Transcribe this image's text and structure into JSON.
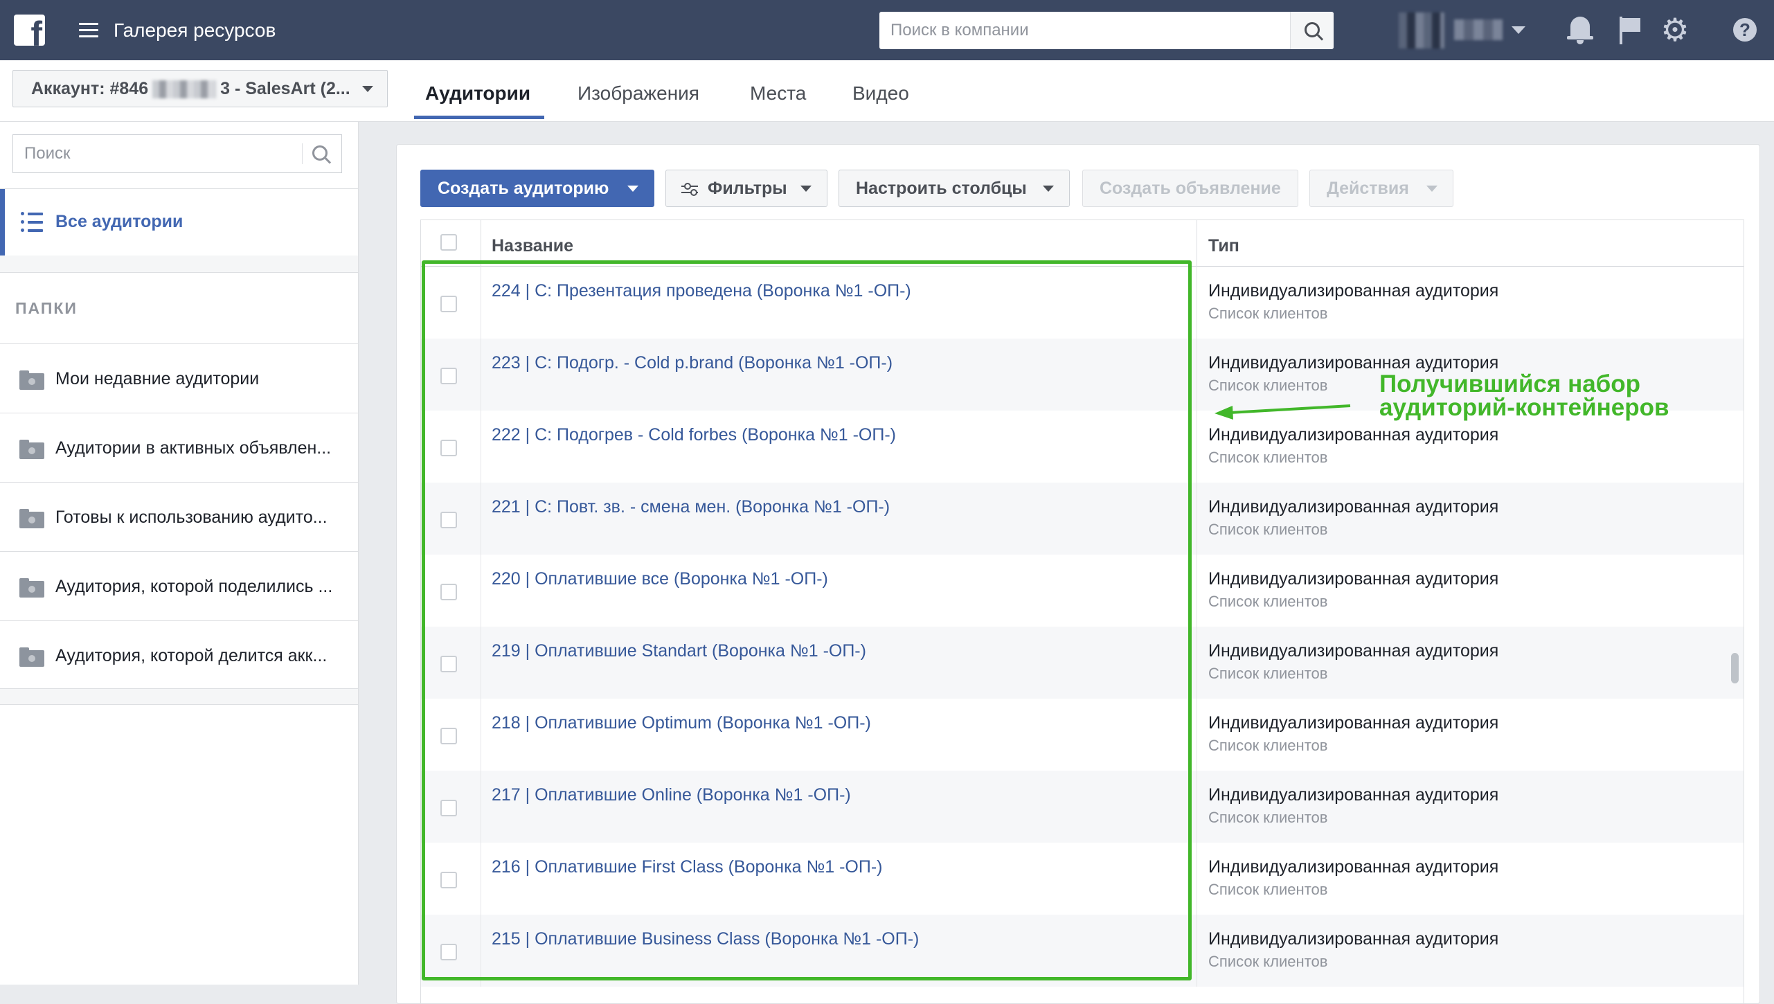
{
  "topbar": {
    "app_title": "Галерея ресурсов",
    "search_placeholder": "Поиск в компании",
    "help_label": "?"
  },
  "subheader": {
    "account_prefix": "Аккаунт: #846",
    "account_suffix": "3 - SalesArt (2...",
    "tabs": [
      {
        "label": "Аудитории",
        "active": true
      },
      {
        "label": "Изображения",
        "active": false
      },
      {
        "label": "Места",
        "active": false
      },
      {
        "label": "Видео",
        "active": false
      }
    ]
  },
  "sidebar": {
    "search_placeholder": "Поиск",
    "all_audiences": "Все аудитории",
    "folders_title": "ПАПКИ",
    "folders": [
      "Мои недавние аудитории",
      "Аудитории в активных объявлен...",
      "Готовы к использованию аудито...",
      "Аудитория, которой поделились ...",
      "Аудитория, которой делится акк..."
    ]
  },
  "toolbar": {
    "create_audience": "Создать аудиторию",
    "filters": "Фильтры",
    "columns": "Настроить столбцы",
    "create_ad": "Создать объявление",
    "actions": "Действия"
  },
  "table": {
    "columns": {
      "name": "Название",
      "type": "Тип"
    },
    "rows": [
      {
        "name": "224 | C: Презентация проведена (Воронка №1 -ОП-)",
        "type": "Индивидуализированная аудитория",
        "subtype": "Список клиентов"
      },
      {
        "name": "223 | C: Подогр. - Cold p.brand (Воронка №1 -ОП-)",
        "type": "Индивидуализированная аудитория",
        "subtype": "Список клиентов"
      },
      {
        "name": "222 | C: Подогрев - Cold forbes (Воронка №1 -ОП-)",
        "type": "Индивидуализированная аудитория",
        "subtype": "Список клиентов"
      },
      {
        "name": "221 | C: Повт. зв. - смена мен. (Воронка №1 -ОП-)",
        "type": "Индивидуализированная аудитория",
        "subtype": "Список клиентов"
      },
      {
        "name": "220 | Оплатившие все (Воронка №1 -ОП-)",
        "type": "Индивидуализированная аудитория",
        "subtype": "Список клиентов"
      },
      {
        "name": "219 | Оплатившие Standart (Воронка №1 -ОП-)",
        "type": "Индивидуализированная аудитория",
        "subtype": "Список клиентов"
      },
      {
        "name": "218 | Оплатившие Optimum (Воронка №1 -ОП-)",
        "type": "Индивидуализированная аудитория",
        "subtype": "Список клиентов"
      },
      {
        "name": "217 | Оплатившие Online (Воронка №1 -ОП-)",
        "type": "Индивидуализированная аудитория",
        "subtype": "Список клиентов"
      },
      {
        "name": "216 | Оплатившие First Class (Воронка №1 -ОП-)",
        "type": "Индивидуализированная аудитория",
        "subtype": "Список клиентов"
      },
      {
        "name": "215 | Оплатившие Business Class (Воронка №1 -ОП-)",
        "type": "Индивидуализированная аудитория",
        "subtype": "Список клиентов"
      }
    ]
  },
  "annotation": {
    "line1": "Получившийся набор",
    "line2": "аудиторий-контейнеров",
    "color": "#42b72a"
  },
  "colors": {
    "topbar": "#3b4862",
    "accent": "#4267b2",
    "link": "#365899"
  }
}
